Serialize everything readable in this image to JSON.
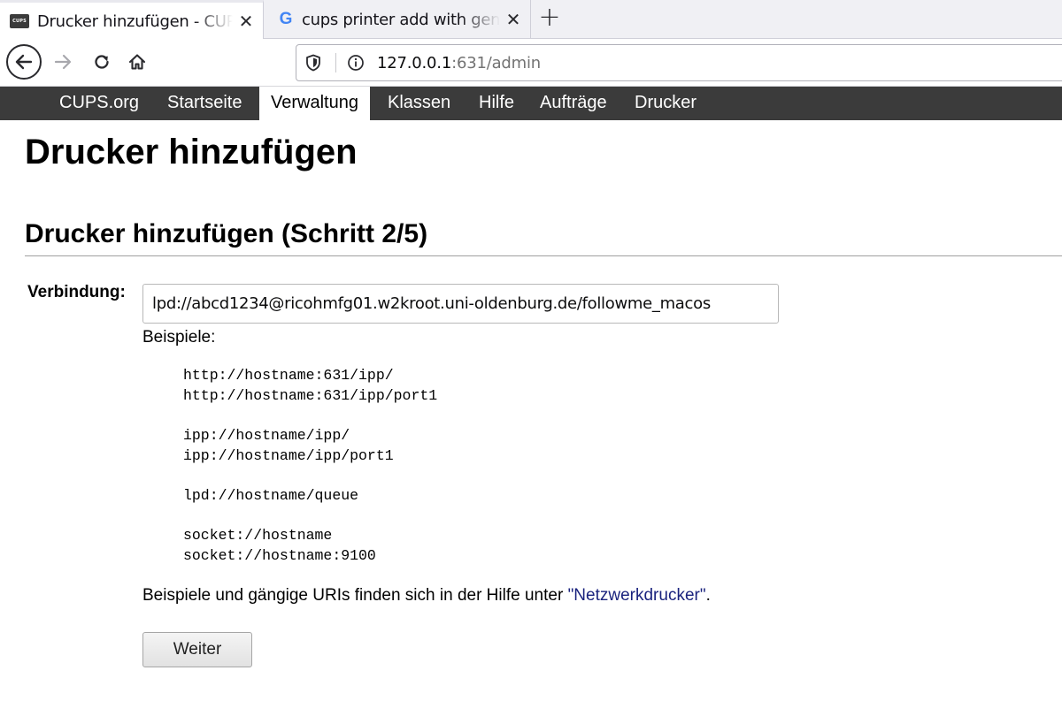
{
  "browser": {
    "tabs": [
      {
        "title": "Drucker hinzufügen - CUPS",
        "active": true,
        "favicon": "cups-favicon-icon"
      },
      {
        "title": "cups printer add with generic",
        "active": false,
        "favicon": "google-favicon-icon"
      }
    ],
    "favicon_cups_text": "CUPS",
    "favicon_google_letter": "G",
    "close_glyph": "✕",
    "new_tab_glyph": "+",
    "url_host": "127.0.0.1",
    "url_rest": ":631/admin"
  },
  "cups_nav": {
    "items": [
      "CUPS.org",
      "Startseite",
      "Verwaltung",
      "Klassen",
      "Hilfe",
      "Aufträge",
      "Drucker"
    ],
    "active_index": 2
  },
  "page": {
    "title": "Drucker hinzufügen",
    "subtitle": "Drucker hinzufügen (Schritt 2/5)",
    "connection_label": "Verbindung:",
    "connection_value": "lpd://abcd1234@ricohmfg01.w2kroot.uni-oldenburg.de/followme_macos",
    "examples_label": "Beispiele:",
    "example_groups": [
      [
        "http://hostname:631/ipp/",
        "http://hostname:631/ipp/port1"
      ],
      [
        "ipp://hostname/ipp/",
        "ipp://hostname/ipp/port1"
      ],
      [
        "lpd://hostname/queue"
      ],
      [
        "socket://hostname",
        "socket://hostname:9100"
      ]
    ],
    "hint_before": "Beispiele und gängige URIs finden sich in der Hilfe unter ",
    "hint_link": "\"Netzwerkdrucker\"",
    "hint_after": ".",
    "continue_button": "Weiter"
  },
  "colors": {
    "cups_menu_bg": "#3b3b3b",
    "link": "#1a237e"
  }
}
